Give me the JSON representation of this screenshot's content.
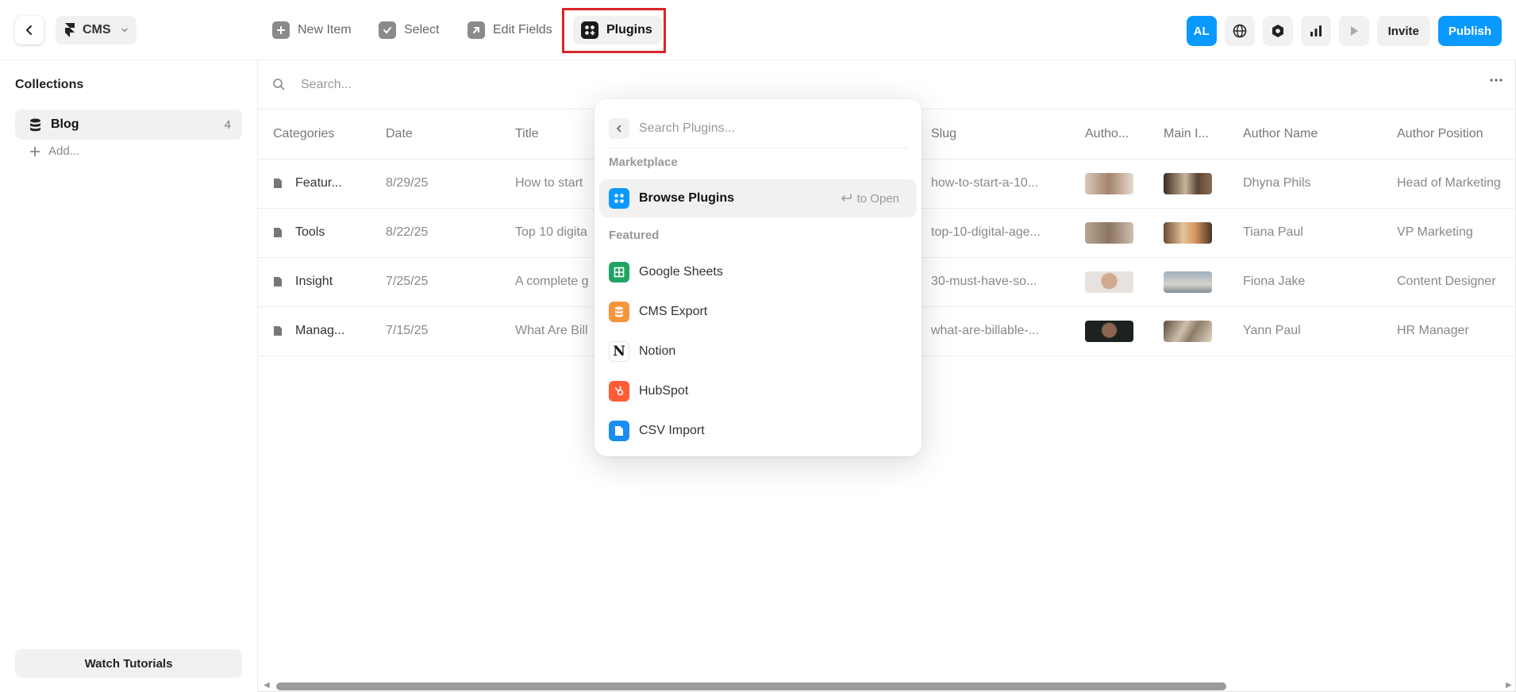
{
  "header": {
    "project_label": "CMS",
    "tools": {
      "new_item": "New Item",
      "select": "Select",
      "edit_fields": "Edit Fields",
      "plugins": "Plugins"
    },
    "avatar_initials": "AL",
    "invite_label": "Invite",
    "publish_label": "Publish"
  },
  "sidebar": {
    "title": "Collections",
    "collection": {
      "label": "Blog",
      "count": "4"
    },
    "add_label": "Add...",
    "tutorials_label": "Watch Tutorials"
  },
  "main": {
    "search_placeholder": "Search...",
    "columns": [
      "Categories",
      "Date",
      "Title",
      "Slug",
      "Autho...",
      "Main I...",
      "Author Name",
      "Author Position"
    ],
    "rows": [
      {
        "category": "Featur...",
        "date": "8/29/25",
        "title": "How to start",
        "slug": "how-to-start-a-10...",
        "author_name": "Dhyna Phils",
        "author_position": "Head of Marketing"
      },
      {
        "category": "Tools",
        "date": "8/22/25",
        "title": "Top 10 digita",
        "slug": "top-10-digital-age...",
        "author_name": "Tiana Paul",
        "author_position": "VP Marketing"
      },
      {
        "category": "Insight",
        "date": "7/25/25",
        "title": "A complete g",
        "slug": "30-must-have-so...",
        "author_name": "Fiona Jake",
        "author_position": "Content Designer"
      },
      {
        "category": "Manag...",
        "date": "7/15/25",
        "title": "What Are Bill",
        "slug": "what-are-billable-...",
        "author_name": "Yann Paul",
        "author_position": "HR Manager"
      }
    ]
  },
  "plugins_menu": {
    "search_placeholder": "Search Plugins...",
    "marketplace_label": "Marketplace",
    "browse": {
      "label": "Browse Plugins",
      "hint": "to Open"
    },
    "featured_label": "Featured",
    "featured": [
      {
        "label": "Google Sheets",
        "icon": "google-sheets-icon",
        "color": "#1fa463"
      },
      {
        "label": "CMS Export",
        "icon": "cms-export-icon",
        "color": "#f7953b"
      },
      {
        "label": "Notion",
        "icon": "notion-icon",
        "color": "#111111"
      },
      {
        "label": "HubSpot",
        "icon": "hubspot-icon",
        "color": "#ff5c35"
      },
      {
        "label": "CSV Import",
        "icon": "csv-import-icon",
        "color": "#1b8cf2"
      }
    ]
  },
  "colors": {
    "accent": "#0a99ff",
    "highlight": "#d9252b"
  }
}
